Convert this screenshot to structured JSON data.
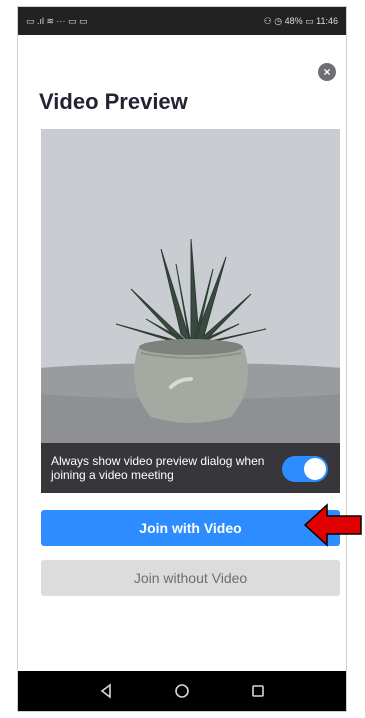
{
  "status_bar": {
    "left_icons": "▭ .ıl ≋ ··· ▭ ▭",
    "right_status": "⚇ ◷ 48% ▭ 11:46"
  },
  "dialog": {
    "close_label": "×",
    "title": "Video Preview",
    "preview": {
      "always_show_text": "Always show video preview dialog when joining a video meeting",
      "toggle_on": true
    },
    "join_with_video_label": "Join with Video",
    "join_without_video_label": "Join without Video"
  },
  "colors": {
    "accent": "#2D8CFF",
    "title_text": "#232333",
    "secondary_button": "#DCDCDC",
    "annotation_arrow": "#E00000"
  },
  "icons": {
    "close": "close-icon",
    "nav_back": "back-triangle-icon",
    "nav_home": "home-circle-icon",
    "nav_recents": "recents-square-icon"
  }
}
